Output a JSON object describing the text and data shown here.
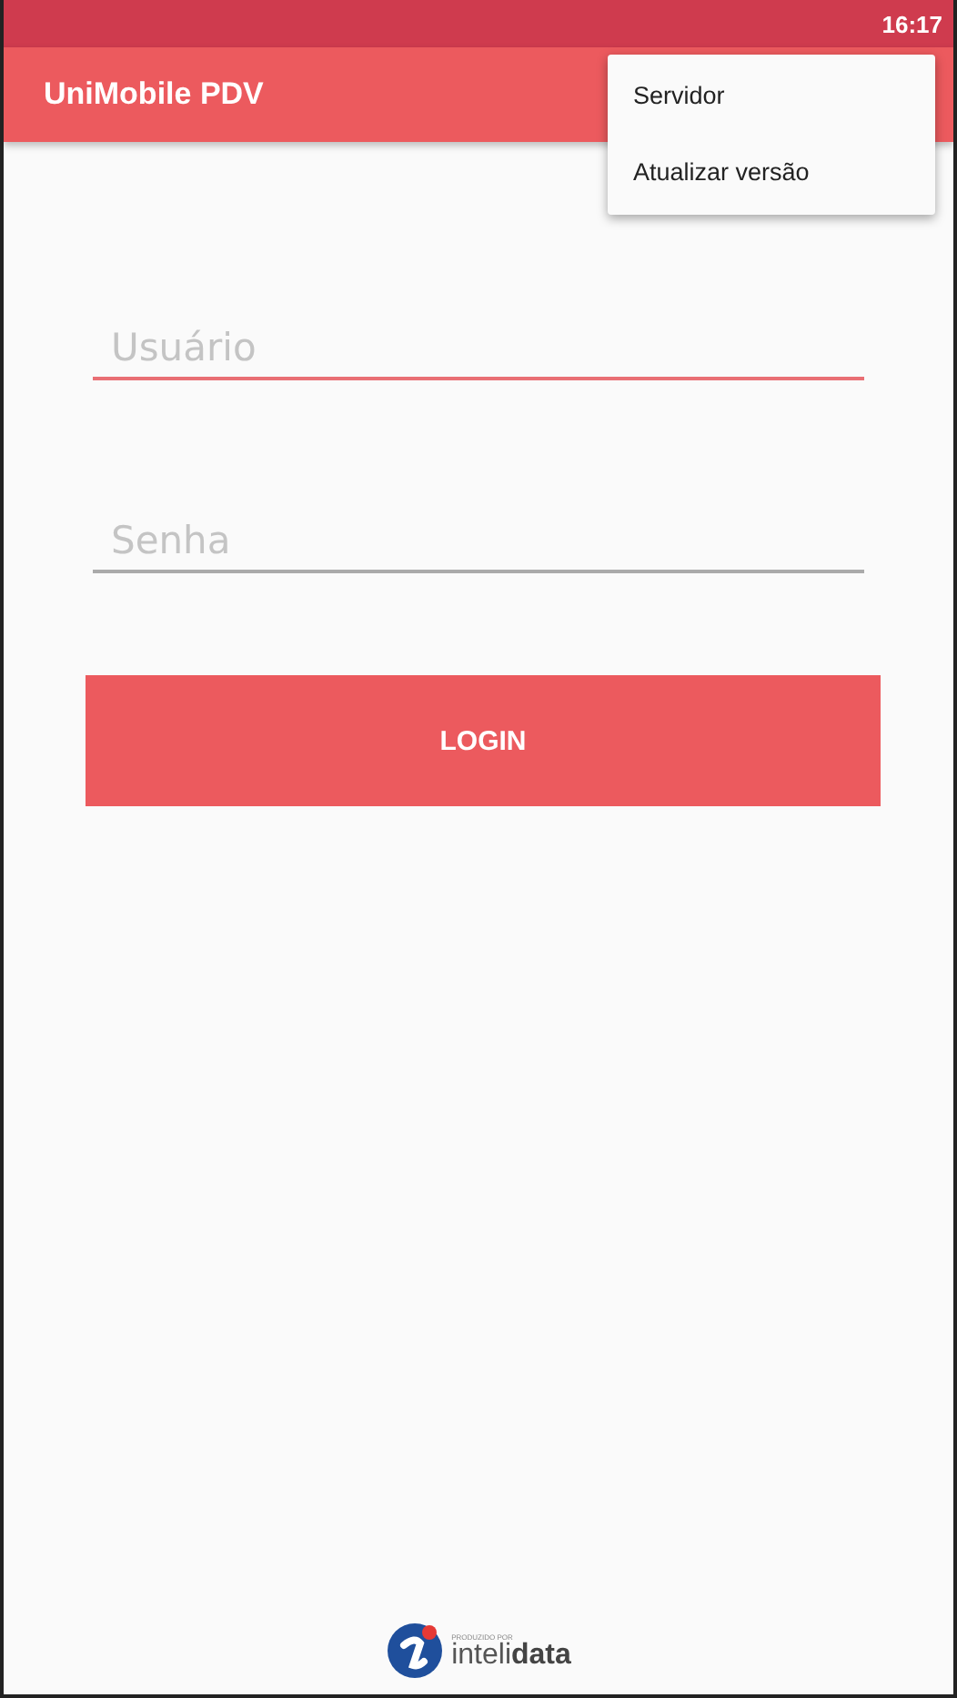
{
  "status_bar": {
    "time": "16:17"
  },
  "app_bar": {
    "title": "UniMobile PDV"
  },
  "menu": {
    "items": [
      {
        "label": "Servidor"
      },
      {
        "label": "Atualizar versão"
      }
    ]
  },
  "fields": [
    {
      "placeholder": "Usuário",
      "focused": true
    },
    {
      "placeholder": "Senha",
      "focused": false
    }
  ],
  "login_button": {
    "label": "LOGIN"
  },
  "footer": {
    "caption": "PRODUZIDO POR",
    "brand": "inteli**data**"
  }
}
